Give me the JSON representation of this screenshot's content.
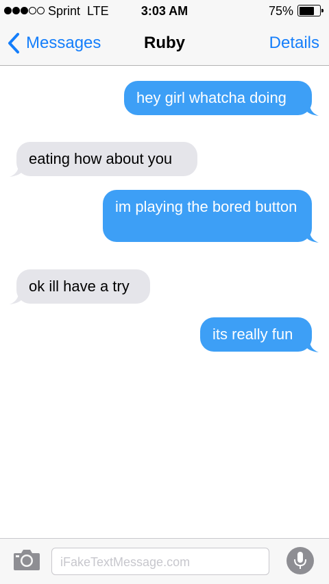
{
  "status_bar": {
    "signal_dots_filled": 3,
    "signal_dots_total": 5,
    "carrier": "Sprint",
    "network": "LTE",
    "time": "3:03 AM",
    "battery_percent": "75%",
    "battery_level": 0.75
  },
  "nav": {
    "back_label": "Messages",
    "title": "Ruby",
    "details_label": "Details"
  },
  "messages": [
    {
      "direction": "sent",
      "text": "hey girl whatcha doing"
    },
    {
      "direction": "received",
      "text": "eating how about you"
    },
    {
      "direction": "sent",
      "text": "im playing the bored button"
    },
    {
      "direction": "received",
      "text": "ok ill have a try"
    },
    {
      "direction": "sent",
      "text": "its really fun"
    }
  ],
  "input": {
    "placeholder": "iFakeTextMessage.com"
  },
  "colors": {
    "accent": "#147efb",
    "sent_bubble": "#3d9ff6",
    "received_bubble": "#e5e5ea"
  },
  "icons": {
    "back": "chevron-left-icon",
    "camera": "camera-icon",
    "mic": "microphone-icon"
  }
}
